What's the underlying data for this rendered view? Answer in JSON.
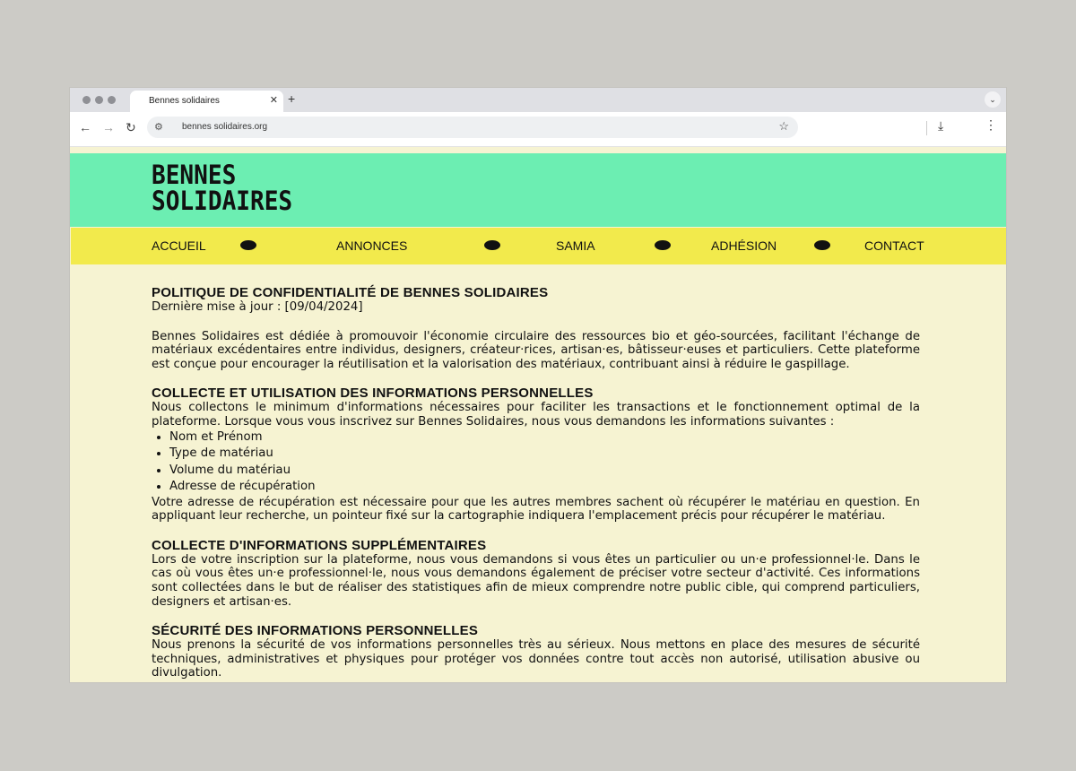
{
  "browser": {
    "tab_title": "Bennes solidaires",
    "tab_close": "✕",
    "new_tab": "+",
    "tab_menu": "⌄",
    "url": "bennes solidaires.org",
    "icons": {
      "back": "←",
      "forward": "→",
      "reload": "↻",
      "site_info": "⚙",
      "star": "☆",
      "download": "⤓",
      "menu": "⋮"
    }
  },
  "site": {
    "logo_line1": "BENNES",
    "logo_line2": "SOLIDAIRES",
    "colors": {
      "header": "#6ceeb2",
      "nav": "#f2ea4c",
      "page": "#f6f3d2"
    },
    "nav": [
      "ACCUEIL",
      "ANNONCES",
      "SAMIA",
      "ADHÉSION",
      "CONTACT"
    ]
  },
  "content": {
    "title": "POLITIQUE DE CONFIDENTIALITÉ DE BENNES SOLIDAIRES",
    "updated": "Dernière mise à jour : [09/04/2024]",
    "intro": "Bennes Solidaires est dédiée à promouvoir l'économie circulaire des ressources bio et géo-sourcées, facilitant l'échange de matériaux excédentaires entre individus, designers, créateur·rices, artisan·es, bâtisseur·euses et particuliers. Cette plateforme est conçue pour encourager la réutilisation et la valorisation des matériaux, contribuant ainsi à réduire le gaspillage.",
    "s1_heading": "COLLECTE ET UTILISATION DES INFORMATIONS PERSONNELLES",
    "s1_text": "Nous collectons le minimum d'informations nécessaires pour faciliter les transactions et le fonctionnement optimal de la plateforme. Lorsque vous vous inscrivez sur Bennes Solidaires, nous vous demandons les informations suivantes :",
    "s1_list": [
      "Nom et Prénom",
      "Type de matériau",
      "Volume du matériau",
      "Adresse de récupération"
    ],
    "s1_after": "Votre adresse de récupération est nécessaire pour que les autres membres sachent où récupérer le matériau en question. En appliquant leur recherche, un pointeur fixé sur la cartographie indiquera l'emplacement précis pour récupérer le matériau.",
    "s2_heading": "COLLECTE D'INFORMATIONS SUPPLÉMENTAIRES",
    "s2_text": "Lors de votre inscription sur la plateforme, nous vous demandons si vous êtes un particulier ou un·e professionnel·le. Dans le cas où vous êtes un·e professionnel·le, nous vous demandons également de préciser votre secteur d'activité. Ces informations sont collectées dans le but de réaliser des statistiques afin de mieux comprendre notre public cible, qui comprend particuliers, designers et artisan·es.",
    "s3_heading": "SÉCURITÉ DES INFORMATIONS PERSONNELLES",
    "s3_text": "Nous prenons la sécurité de vos informations personnelles très au sérieux. Nous mettons en place des mesures de sécurité techniques, administratives et physiques pour protéger vos données contre tout accès non autorisé, utilisation abusive ou divulgation."
  }
}
